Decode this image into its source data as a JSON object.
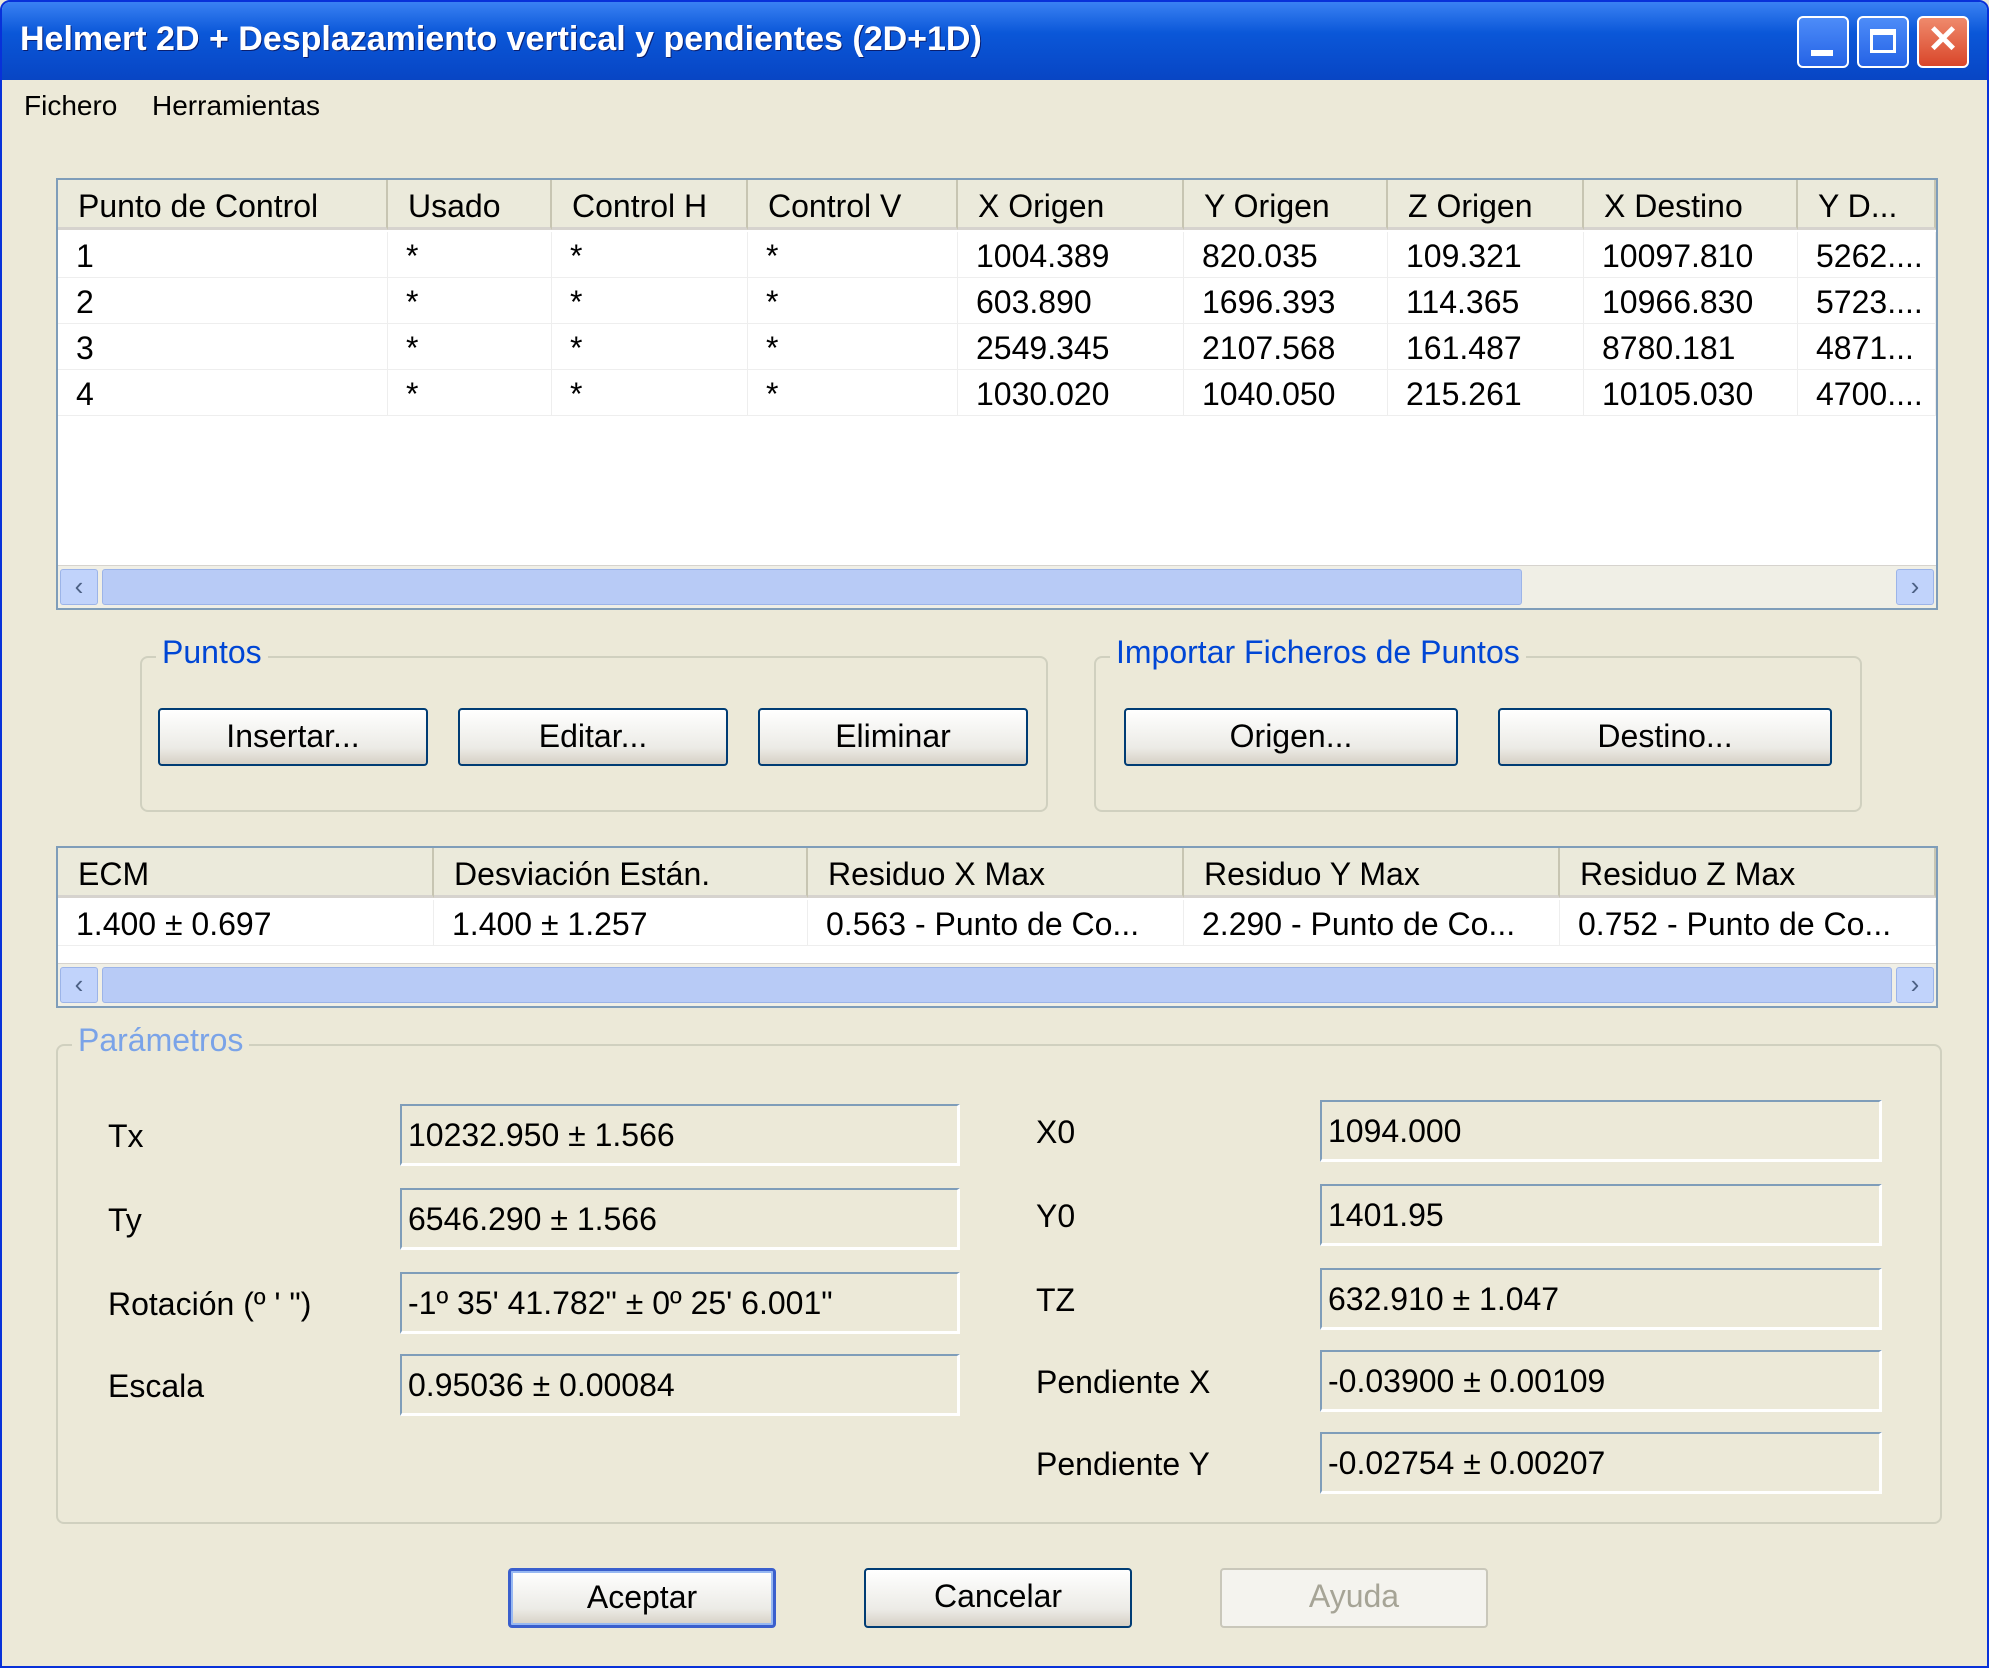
{
  "window": {
    "title": "Helmert 2D + Desplazamiento vertical y pendientes (2D+1D)"
  },
  "menu": [
    "Fichero",
    "Herramientas"
  ],
  "points_grid": {
    "columns": [
      "Punto de Control",
      "Usado",
      "Control H",
      "Control V",
      "X Origen",
      "Y Origen",
      "Z Origen",
      "X Destino",
      "Y D..."
    ],
    "rows": [
      [
        "1",
        "*",
        "*",
        "*",
        "1004.389",
        "820.035",
        "109.321",
        "10097.810",
        "5262...."
      ],
      [
        "2",
        "*",
        "*",
        "*",
        "603.890",
        "1696.393",
        "114.365",
        "10966.830",
        "5723...."
      ],
      [
        "3",
        "*",
        "*",
        "*",
        "2549.345",
        "2107.568",
        "161.487",
        "8780.181",
        "4871..."
      ],
      [
        "4",
        "*",
        "*",
        "*",
        "1030.020",
        "1040.050",
        "215.261",
        "10105.030",
        "4700...."
      ]
    ]
  },
  "group_puntos": {
    "label": "Puntos",
    "buttons": [
      "Insertar...",
      "Editar...",
      "Eliminar"
    ]
  },
  "group_importar": {
    "label": "Importar Ficheros de Puntos",
    "buttons": [
      "Origen...",
      "Destino..."
    ]
  },
  "stats_grid": {
    "columns": [
      "ECM",
      "Desviación Están.",
      "Residuo X Max",
      "Residuo Y Max",
      "Residuo Z Max"
    ],
    "row": [
      "1.400 ± 0.697",
      "1.400 ± 1.257",
      "0.563 - Punto de Co...",
      "2.290 - Punto de Co...",
      "0.752 - Punto de Co..."
    ]
  },
  "params": {
    "label": "Parámetros",
    "left": [
      {
        "label": "Tx",
        "value": "10232.950 ± 1.566"
      },
      {
        "label": "Ty",
        "value": "6546.290 ± 1.566"
      },
      {
        "label": "Rotación (º ' \")",
        "value": "-1º 35' 41.782\" ± 0º 25' 6.001\""
      },
      {
        "label": "Escala",
        "value": "0.95036 ± 0.00084"
      }
    ],
    "right": [
      {
        "label": "X0",
        "value": "1094.000"
      },
      {
        "label": "Y0",
        "value": "1401.95"
      },
      {
        "label": "TZ",
        "value": "632.910 ± 1.047"
      },
      {
        "label": "Pendiente X",
        "value": "-0.03900 ± 0.00109"
      },
      {
        "label": "Pendiente Y",
        "value": "-0.02754 ± 0.00207"
      }
    ]
  },
  "footer": {
    "accept": "Aceptar",
    "cancel": "Cancelar",
    "help": "Ayuda"
  }
}
